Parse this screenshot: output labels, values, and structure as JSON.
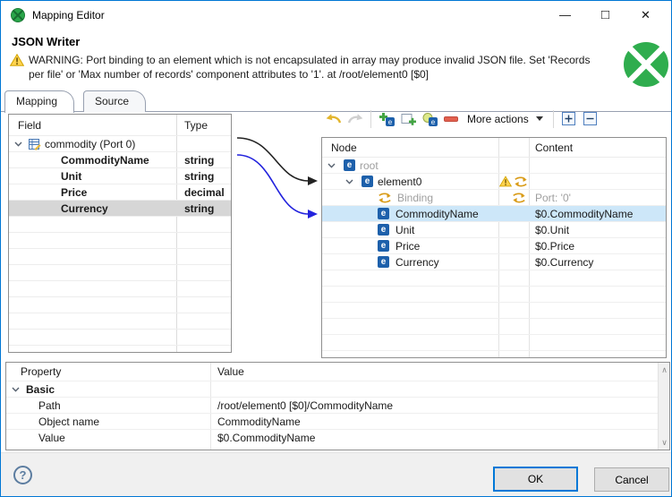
{
  "window": {
    "title": "Mapping Editor"
  },
  "titlebar": {
    "minimize": "—",
    "maximize": "□",
    "close": "✕"
  },
  "header": {
    "title": "JSON Writer",
    "warning": "WARNING: Port binding to an element which is not encapsulated in array may produce invalid JSON file. Set 'Records per file' or 'Max number of records' component attributes to '1'. at /root/element0 [$0]"
  },
  "tabs": {
    "mapping": "Mapping",
    "source": "Source"
  },
  "field_table": {
    "field_header": "Field",
    "type_header": "Type",
    "root_label": "commodity (Port 0)",
    "rows": [
      {
        "field": "CommodityName",
        "type": "string"
      },
      {
        "field": "Unit",
        "type": "string"
      },
      {
        "field": "Price",
        "type": "decimal"
      },
      {
        "field": "Currency",
        "type": "string"
      }
    ],
    "selected_row": "Currency"
  },
  "toolbar": {
    "more_actions": "More actions"
  },
  "node_tree": {
    "node_header": "Node",
    "content_header": "Content",
    "rows": [
      {
        "label": "root",
        "content": ""
      },
      {
        "label": "element0",
        "content": ""
      },
      {
        "label": "Binding",
        "content": "Port: '0'"
      },
      {
        "label": "CommodityName",
        "content": "$0.CommodityName"
      },
      {
        "label": "Unit",
        "content": "$0.Unit"
      },
      {
        "label": "Price",
        "content": "$0.Price"
      },
      {
        "label": "Currency",
        "content": "$0.Currency"
      }
    ],
    "selected_row": "CommodityName"
  },
  "properties": {
    "property_header": "Property",
    "value_header": "Value",
    "group": "Basic",
    "rows": [
      {
        "property": "Path",
        "value": "/root/element0 [$0]/CommodityName"
      },
      {
        "property": "Object name",
        "value": "CommodityName"
      },
      {
        "property": "Value",
        "value": "$0.CommodityName"
      }
    ]
  },
  "footer": {
    "help": "?",
    "ok": "OK",
    "cancel": "Cancel"
  },
  "icons": {
    "element_letter": "e",
    "scroll_up": "∧",
    "scroll_down": "∨"
  },
  "colors": {
    "accent_blue": "#0078d7",
    "clover_green": "#2fad4e",
    "selection_blue": "#cde7f9",
    "selection_gray": "#d6d6d6",
    "warning_yellow": "#ffd34f",
    "binding_orange": "#d99b17"
  }
}
